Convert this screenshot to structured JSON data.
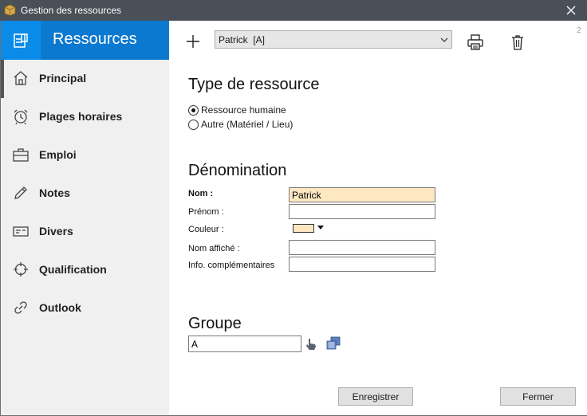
{
  "window": {
    "title": "Gestion des ressources"
  },
  "sidebar": {
    "header": "Ressources",
    "items": [
      {
        "label": "Principal",
        "icon": "home-icon",
        "active": true
      },
      {
        "label": "Plages horaires",
        "icon": "alarm-clock-icon"
      },
      {
        "label": "Emploi",
        "icon": "briefcase-icon"
      },
      {
        "label": "Notes",
        "icon": "pencil-icon"
      },
      {
        "label": "Divers",
        "icon": "card-icon"
      },
      {
        "label": "Qualification",
        "icon": "crosshair-icon"
      },
      {
        "label": "Outlook",
        "icon": "link-icon"
      }
    ]
  },
  "toolbar": {
    "resource_selected": "Patrick  [A]",
    "page_number": "2"
  },
  "type_section": {
    "title": "Type de ressource",
    "options": [
      {
        "label": "Ressource humaine",
        "checked": true
      },
      {
        "label": "Autre (Matériel / Lieu)",
        "checked": false
      }
    ]
  },
  "denomination": {
    "title": "Dénomination",
    "nom_label": "Nom :",
    "nom_value": "Patrick",
    "prenom_label": "Prénom :",
    "prenom_value": "",
    "couleur_label": "Couleur :",
    "couleur_value": "#fde8c2",
    "nom_affiche_label": "Nom affiché :",
    "nom_affiche_value": "",
    "info_label": "Info. complémentaires",
    "info_value": ""
  },
  "groupe": {
    "title": "Groupe",
    "value": "A"
  },
  "buttons": {
    "save": "Enregistrer",
    "close": "Fermer"
  }
}
